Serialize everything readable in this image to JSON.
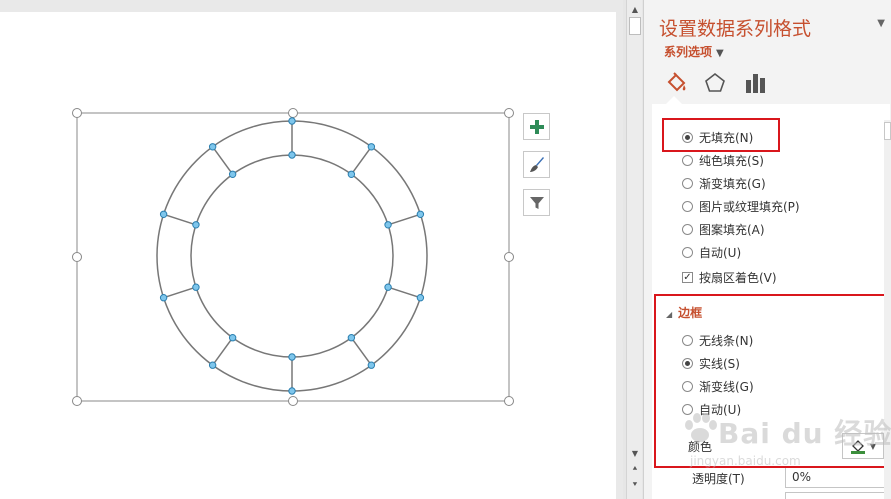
{
  "pane": {
    "title": "设置数据系列格式",
    "series_options_label": "系列选项",
    "close_glyph": "▼"
  },
  "fill_options": [
    {
      "label": "无填充(N)",
      "selected": true
    },
    {
      "label": "纯色填充(S)",
      "selected": false
    },
    {
      "label": "渐变填充(G)",
      "selected": false
    },
    {
      "label": "图片或纹理填充(P)",
      "selected": false
    },
    {
      "label": "图案填充(A)",
      "selected": false
    },
    {
      "label": "自动(U)",
      "selected": false
    }
  ],
  "vary_colors": {
    "label": "按扇区着色(V)",
    "checked": true
  },
  "border": {
    "header": "边框",
    "options": [
      {
        "label": "无线条(N)",
        "selected": false
      },
      {
        "label": "实线(S)",
        "selected": true
      },
      {
        "label": "渐变线(G)",
        "selected": false
      },
      {
        "label": "自动(U)",
        "selected": false
      }
    ],
    "color_label": "颜色",
    "transparency_label": "透明度(T)",
    "transparency_value": "0%"
  },
  "colors": {
    "accent": "#c6502f",
    "highlight": "#d9161c",
    "handle": "#7ec6ec"
  },
  "chart_tools": [
    "plus-icon",
    "brush-icon",
    "filter-icon"
  ],
  "chart_data": {
    "type": "pie",
    "variant": "doughnut",
    "values": [
      1,
      1,
      1,
      1,
      1,
      1,
      1,
      1,
      1,
      1
    ],
    "fill": "none",
    "border": "solid",
    "legend": "none"
  },
  "watermark": {
    "text": "Bai du 经验",
    "url": "jingyan.baidu.com"
  }
}
